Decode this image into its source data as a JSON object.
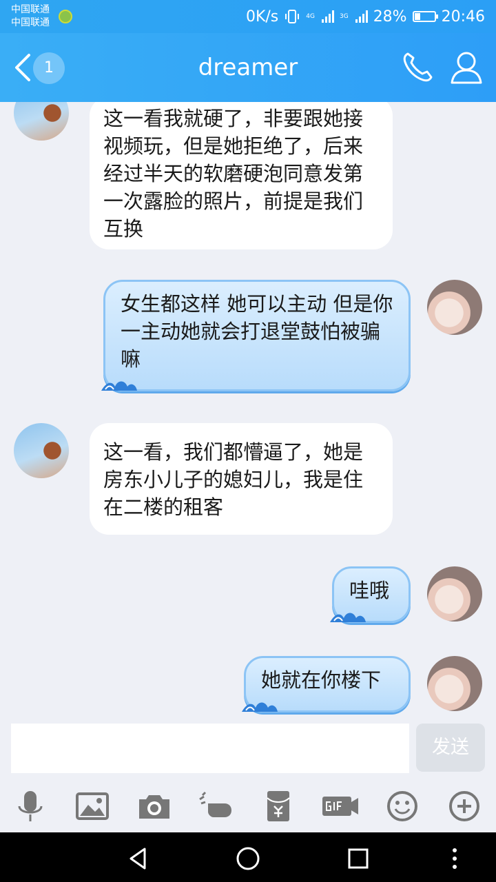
{
  "status_bar": {
    "carrier_1": "中国联通",
    "carrier_2": "中国联通",
    "speed": "0K/s",
    "net_1": "4G",
    "net_2": "3G",
    "battery_percent": "28%",
    "battery_level": 0.28,
    "time": "20:46"
  },
  "header": {
    "title": "dreamer",
    "unread_count": "1",
    "back_icon": "chevron-left-icon",
    "call_icon": "phone-icon",
    "profile_icon": "person-icon"
  },
  "messages": [
    {
      "side": "left",
      "text": "这一看我就硬了，非要跟她接视频玩，但是她拒绝了，后来经过半天的软磨硬泡同意发第一次露脸的照片，前提是我们互换"
    },
    {
      "side": "right",
      "text": "女生都这样 她可以主动 但是你一主动她就会打退堂鼓怕被骗嘛"
    },
    {
      "side": "left",
      "text": "这一看，我们都懵逼了，她是房东小儿子的媳妇儿，我是住在二楼的租客"
    },
    {
      "side": "right",
      "text": "哇哦"
    },
    {
      "side": "right",
      "text": "她就在你楼下"
    }
  ],
  "input": {
    "value": "",
    "send_label": "发送"
  },
  "toolbar": [
    "microphone-icon",
    "image-icon",
    "camera-icon",
    "poke-hand-icon",
    "red-packet-icon",
    "gif-icon",
    "emoji-icon",
    "plus-icon"
  ],
  "nav_bar": [
    "back-triangle-icon",
    "home-circle-icon",
    "recents-square-icon",
    "more-dots-icon"
  ],
  "colors": {
    "accent": "#2d9ef7",
    "outgoing_bubble": "#c9e5fc",
    "background": "#eef0f6"
  }
}
